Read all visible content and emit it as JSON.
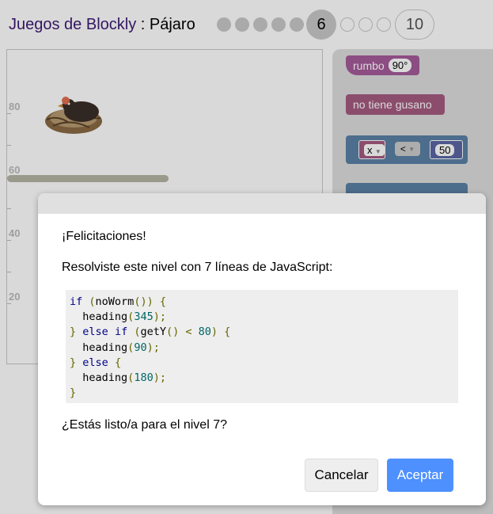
{
  "header": {
    "app_title": "Juegos de Blockly",
    "separator": " : ",
    "game_name": "Pájaro",
    "levels": {
      "done_count": 5,
      "current": "6",
      "last": "10"
    }
  },
  "visualization": {
    "axis_labels": [
      "80",
      "60",
      "40",
      "20"
    ]
  },
  "toolbox": {
    "heading_block": {
      "label": "rumbo",
      "value": "90°"
    },
    "noworm_block": {
      "label": "no tiene gusano"
    },
    "compare_block": {
      "var": "x",
      "op": "<",
      "value": "50"
    }
  },
  "dialog": {
    "congrats": "¡Felicitaciones!",
    "solved_text": "Resolviste este nivel con 7 líneas de JavaScript:",
    "ready_text": "¿Estás listo/a para el nivel 7?",
    "cancel_label": "Cancelar",
    "ok_label": "Aceptar",
    "code": {
      "kw_if": "if",
      "kw_else": "else",
      "fn_noworm": "noWorm",
      "fn_gety": "getY",
      "fn_heading": "heading",
      "n345": "345",
      "n80": "80",
      "n90": "90",
      "n180": "180"
    }
  }
}
